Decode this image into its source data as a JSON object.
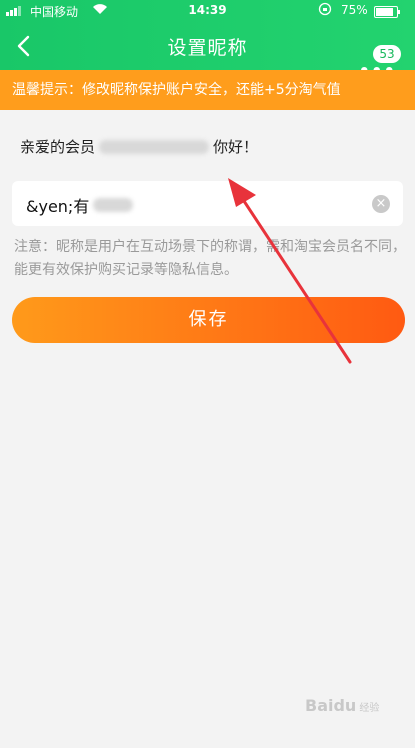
{
  "status_bar": {
    "carrier": "中国移动",
    "time": "14:39",
    "battery": "75%"
  },
  "nav": {
    "title": "设置昵称",
    "badge": "53"
  },
  "tip": {
    "text": "温馨提示：修改昵称保护账户安全，还能+5分淘气值"
  },
  "greeting": {
    "prefix": "亲爱的会员",
    "suffix": "你好！"
  },
  "nickname_field": {
    "value": "&yen;有"
  },
  "note": {
    "text": "注意：昵称是用户在互动场景下的称谓，需和淘宝会员名不同，能更有效保护购买记录等隐私信息。"
  },
  "save_button": {
    "label": "保存"
  },
  "watermark": {
    "text": "Baidu",
    "sub": "经验"
  },
  "colors": {
    "header_green": "#19c768",
    "tip_orange": "#ff9d1c",
    "button_start": "#ff9a1a",
    "button_end": "#ff5a12",
    "annotation_arrow": "#e8333b"
  }
}
